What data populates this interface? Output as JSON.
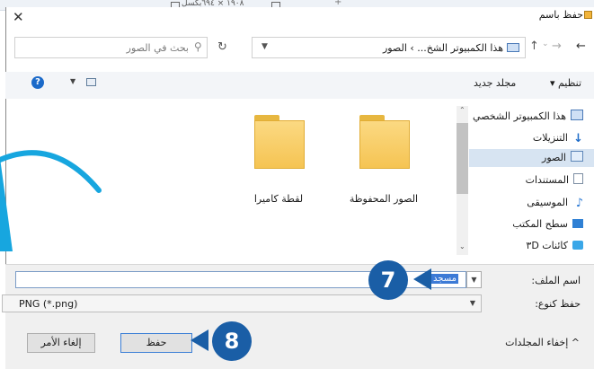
{
  "statusbar": {
    "size_text": "١٩٠٨ × ٦٩٤بكسل"
  },
  "dialog": {
    "title": "حفظ باسم",
    "close": "✕"
  },
  "nav": {
    "back": "←",
    "forward": "→",
    "recent": "⌄",
    "up": "↑",
    "breadcrumb": "هذا الكمبيوتر الشخ... › الصور",
    "search_placeholder": "بحث في الصور",
    "refresh": "↻"
  },
  "toolbar": {
    "organize": "تنظيم ▾",
    "new_folder": "مجلد جديد",
    "help": "?"
  },
  "folders": [
    {
      "label": "الصور المحفوظة"
    },
    {
      "label": "لقطة كاميرا"
    }
  ],
  "sidebar": {
    "items": [
      {
        "label": "هذا الكمبيوتر الشخصي",
        "icon": "pc-icon"
      },
      {
        "label": "التنزيلات",
        "icon": "downloads-icon"
      },
      {
        "label": "الصور",
        "icon": "pictures-icon",
        "selected": true
      },
      {
        "label": "المستندات",
        "icon": "documents-icon"
      },
      {
        "label": "الموسيقى",
        "icon": "music-icon"
      },
      {
        "label": "سطح المكتب",
        "icon": "desktop-icon"
      },
      {
        "label": "كائنات ٣D",
        "icon": "objects3d-icon"
      }
    ]
  },
  "form": {
    "filename_label": "اسم الملف:",
    "filename_value": "مسجد",
    "filetype_label": "حفظ كنوع:",
    "filetype_value": "PNG (*.png)"
  },
  "footer": {
    "hide_folders": "إخفاء المجلدات",
    "save": "حفظ",
    "cancel": "إلغاء الأمر"
  },
  "callouts": {
    "step7": "7",
    "step8": "8"
  },
  "colors": {
    "callout": "#1a5ea6",
    "accent": "#1b6ac9",
    "selection": "#d7e4f2",
    "folder": "#f5c453"
  }
}
